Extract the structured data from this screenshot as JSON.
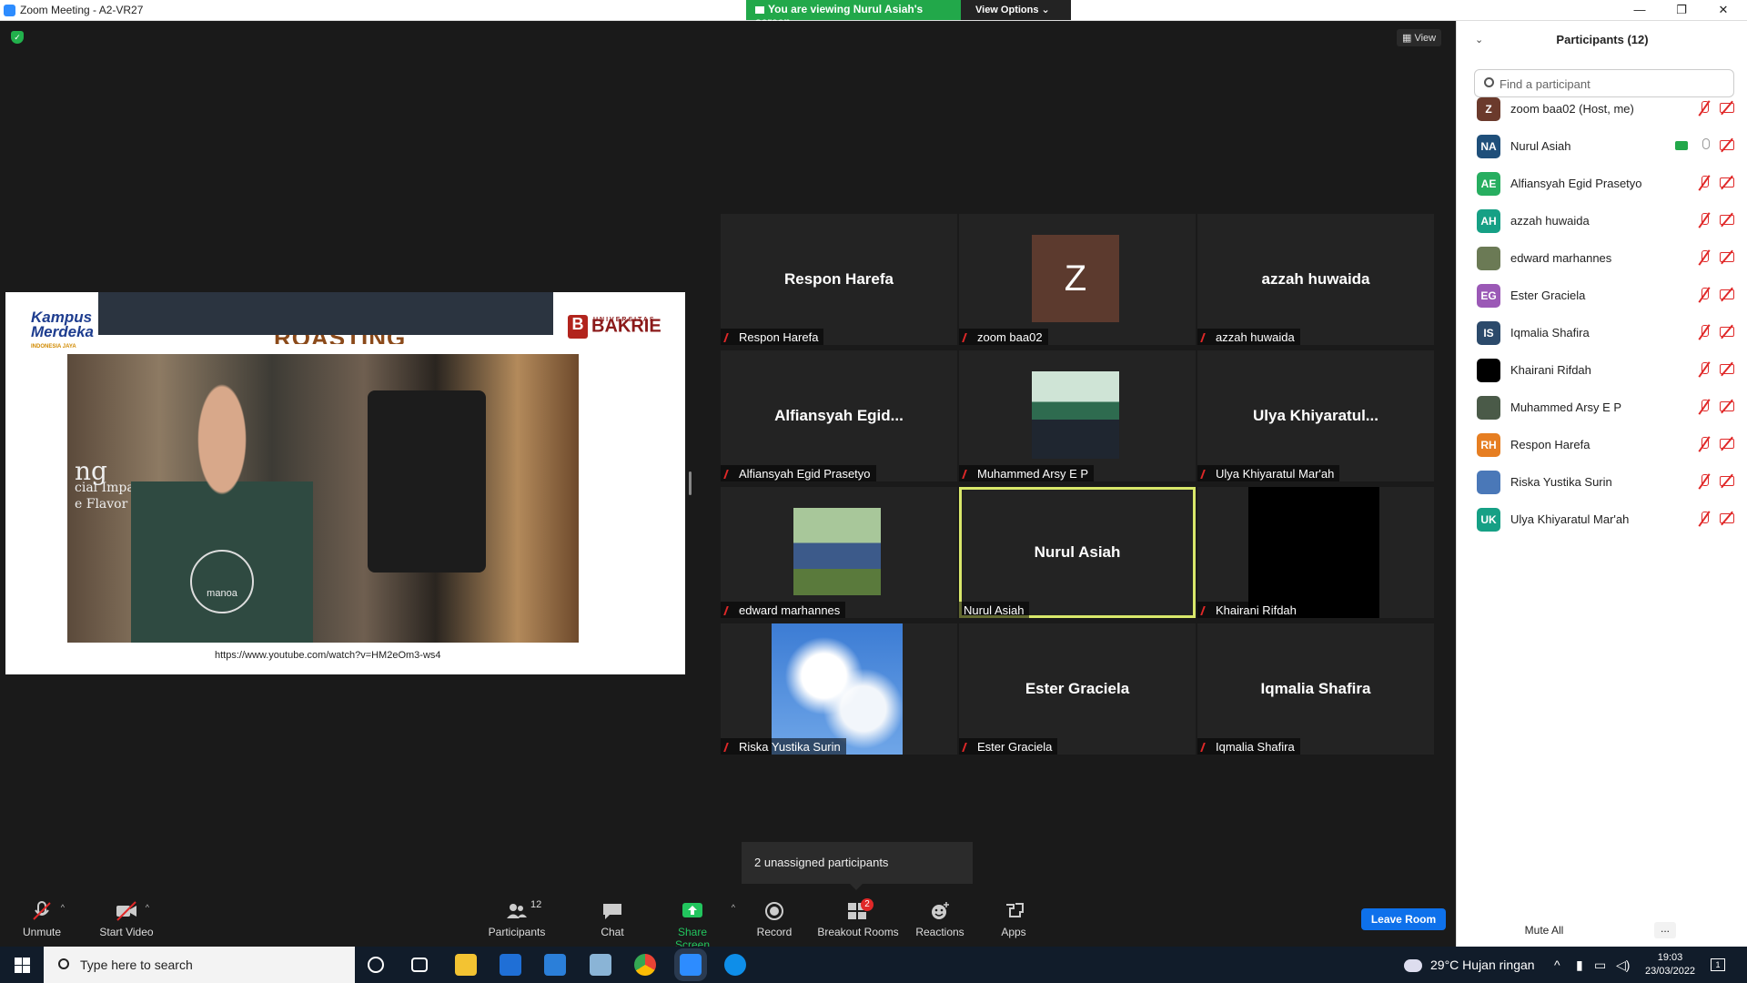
{
  "window": {
    "title": "Zoom Meeting - A2-VR27",
    "minimize": "—",
    "restore": "❐",
    "close": "✕"
  },
  "banner": {
    "viewing": "You are viewing Nurul Asiah's screen",
    "options": "View Options ⌄"
  },
  "topbar": {
    "view_label": "View"
  },
  "shared_screen": {
    "kampus_line1": "Kampus",
    "kampus_line2": "Merdeka",
    "kampus_sub": "INDONESIA JAYA",
    "heading": "ROASTING",
    "uni_small": "UNIVERSITAS",
    "uni_name": "BAKRIE",
    "uni_logo": "B",
    "wall_text_1": "ng",
    "wall_text_2": "cial Impact",
    "wall_text_3": "e Flavor",
    "shirt_logo": "manoa",
    "url": "https://www.youtube.com/watch?v=HM2eOm3-ws4"
  },
  "gallery": [
    {
      "big": "Respon Harefa",
      "label": "Respon Harefa",
      "muted": true,
      "kind": "name"
    },
    {
      "big": "Z",
      "label": "zoom baa02",
      "muted": true,
      "kind": "avatar"
    },
    {
      "big": "azzah huwaida",
      "label": "azzah huwaida",
      "muted": true,
      "kind": "name"
    },
    {
      "big": "Alfiansyah  Egid...",
      "label": "Alfiansyah Egid Prasetyo",
      "muted": true,
      "kind": "name"
    },
    {
      "big": "",
      "label": "Muhammed Arsy E P",
      "muted": true,
      "kind": "photo-group"
    },
    {
      "big": "Ulya  Khiyaratul...",
      "label": "Ulya Khiyaratul Mar'ah",
      "muted": true,
      "kind": "name"
    },
    {
      "big": "",
      "label": "edward marhannes",
      "muted": true,
      "kind": "photo-man"
    },
    {
      "big": "Nurul Asiah",
      "label": "Nurul Asiah",
      "muted": false,
      "kind": "name",
      "active": true
    },
    {
      "big": "",
      "label": "Khairani Rifdah",
      "muted": true,
      "kind": "black"
    },
    {
      "big": "",
      "label": "Riska Yustika Surin",
      "muted": true,
      "kind": "photo-sky"
    },
    {
      "big": "Ester Graciela",
      "label": "Ester Graciela",
      "muted": true,
      "kind": "name"
    },
    {
      "big": "Iqmalia Shafira",
      "label": "Iqmalia Shafira",
      "muted": true,
      "kind": "name"
    }
  ],
  "unassigned": "2 unassigned participants",
  "toolbar": {
    "unmute": "Unmute",
    "start_video": "Start Video",
    "participants": "Participants",
    "participants_count": "12",
    "chat": "Chat",
    "share_screen": "Share Screen",
    "record": "Record",
    "breakout_rooms": "Breakout Rooms",
    "breakout_badge": "2",
    "reactions": "Reactions",
    "apps": "Apps",
    "leave": "Leave Room"
  },
  "panel": {
    "title": "Participants (12)",
    "search_placeholder": "Find a participant",
    "mute_all": "Mute All",
    "more": "...",
    "participants": [
      {
        "initials": "Z",
        "name": "zoom baa02 (Host, me)",
        "color": "#6b3a2c"
      },
      {
        "initials": "NA",
        "name": "Nurul Asiah",
        "color": "#1f4f7a",
        "sharing": true
      },
      {
        "initials": "AE",
        "name": "Alfiansyah Egid Prasetyo",
        "color": "#27ae60"
      },
      {
        "initials": "AH",
        "name": "azzah huwaida",
        "color": "#16a085"
      },
      {
        "initials": "",
        "name": "edward marhannes",
        "color": "#6b7a55"
      },
      {
        "initials": "EG",
        "name": "Ester Graciela",
        "color": "#9b59b6"
      },
      {
        "initials": "IS",
        "name": "Iqmalia Shafira",
        "color": "#2c4a6b"
      },
      {
        "initials": "",
        "name": "Khairani Rifdah",
        "color": "#000000"
      },
      {
        "initials": "",
        "name": "Muhammed Arsy E P",
        "color": "#4a5a48"
      },
      {
        "initials": "RH",
        "name": "Respon Harefa",
        "color": "#e67e22"
      },
      {
        "initials": "",
        "name": "Riska Yustika Surin",
        "color": "#4a78b8"
      },
      {
        "initials": "UK",
        "name": "Ulya Khiyaratul Mar'ah",
        "color": "#16a085"
      }
    ]
  },
  "taskbar": {
    "search_placeholder": "Type here to search",
    "weather": "29°C  Hujan ringan",
    "time": "19:03",
    "date": "23/03/2022",
    "notification_count": "1"
  }
}
